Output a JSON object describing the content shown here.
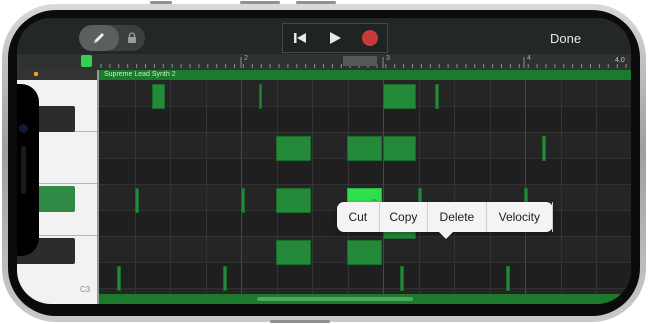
{
  "toolbar": {
    "pencil_icon": "pencil-icon",
    "lock_icon": "lock-icon",
    "transport": {
      "rewind_icon": "skip-to-start-icon",
      "play_icon": "play-icon",
      "record_icon": "record-icon",
      "record_color": "#c83a3a"
    },
    "done_label": "Done"
  },
  "ruler": {
    "markers": [
      "2",
      "3",
      "4"
    ],
    "end_label": "4.0"
  },
  "keyboard": {
    "octave_label": "C3",
    "active_color": "#2f8a45"
  },
  "region": {
    "name": "Supreme Lead Synth 2",
    "color": "#1c7a2e"
  },
  "notes": {
    "color": "#238a3a",
    "selected_color": "#2ee04c",
    "count": 21
  },
  "context_menu": {
    "items": [
      "Cut",
      "Copy",
      "Delete",
      "Velocity"
    ]
  }
}
